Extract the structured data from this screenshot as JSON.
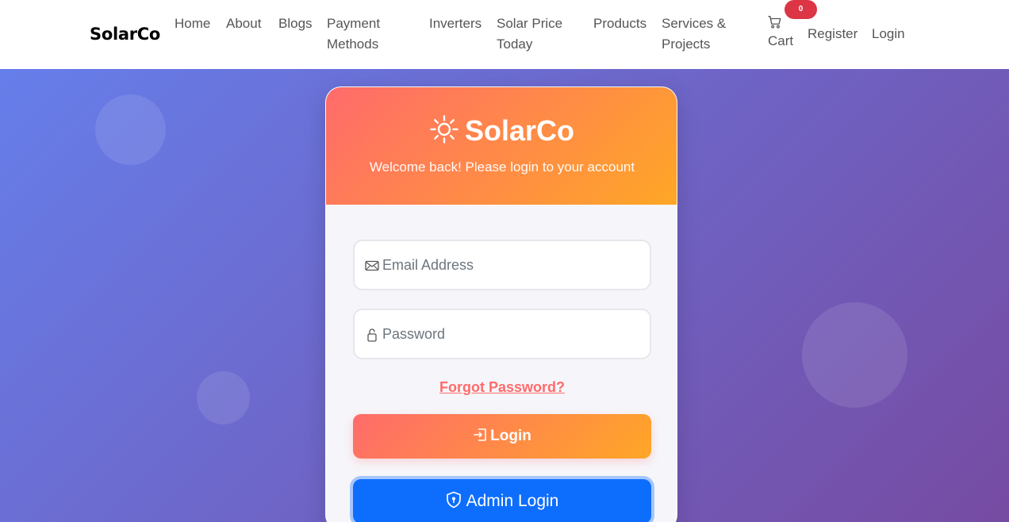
{
  "navbar": {
    "brand": "SolarCo",
    "links": [
      "Home",
      "About",
      "Blogs",
      "Payment Methods",
      "Inverters",
      "Solar Price Today",
      "Products",
      "Services & Projects"
    ],
    "cart_label": "Cart",
    "cart_count": "0",
    "register_label": "Register",
    "login_label": "Login"
  },
  "card": {
    "title": "SolarCo",
    "subtitle": "Welcome back! Please login to your account",
    "email_placeholder": "Email Address",
    "password_placeholder": "Password",
    "forgot_label": "Forgot Password?",
    "login_button": "Login",
    "admin_button": "Admin Login"
  },
  "colors": {
    "accent_gradient_start": "#ff6b6b",
    "accent_gradient_end": "#ffa726",
    "bg_gradient_start": "#667eea",
    "bg_gradient_end": "#764ba2",
    "admin_blue": "#0d6efd",
    "badge_red": "#dc3545"
  },
  "icons": {
    "brand": "sun-icon",
    "email": "envelope-icon",
    "password": "lock-icon",
    "login": "login-arrow-icon",
    "admin": "shield-icon",
    "cart": "cart-icon"
  }
}
